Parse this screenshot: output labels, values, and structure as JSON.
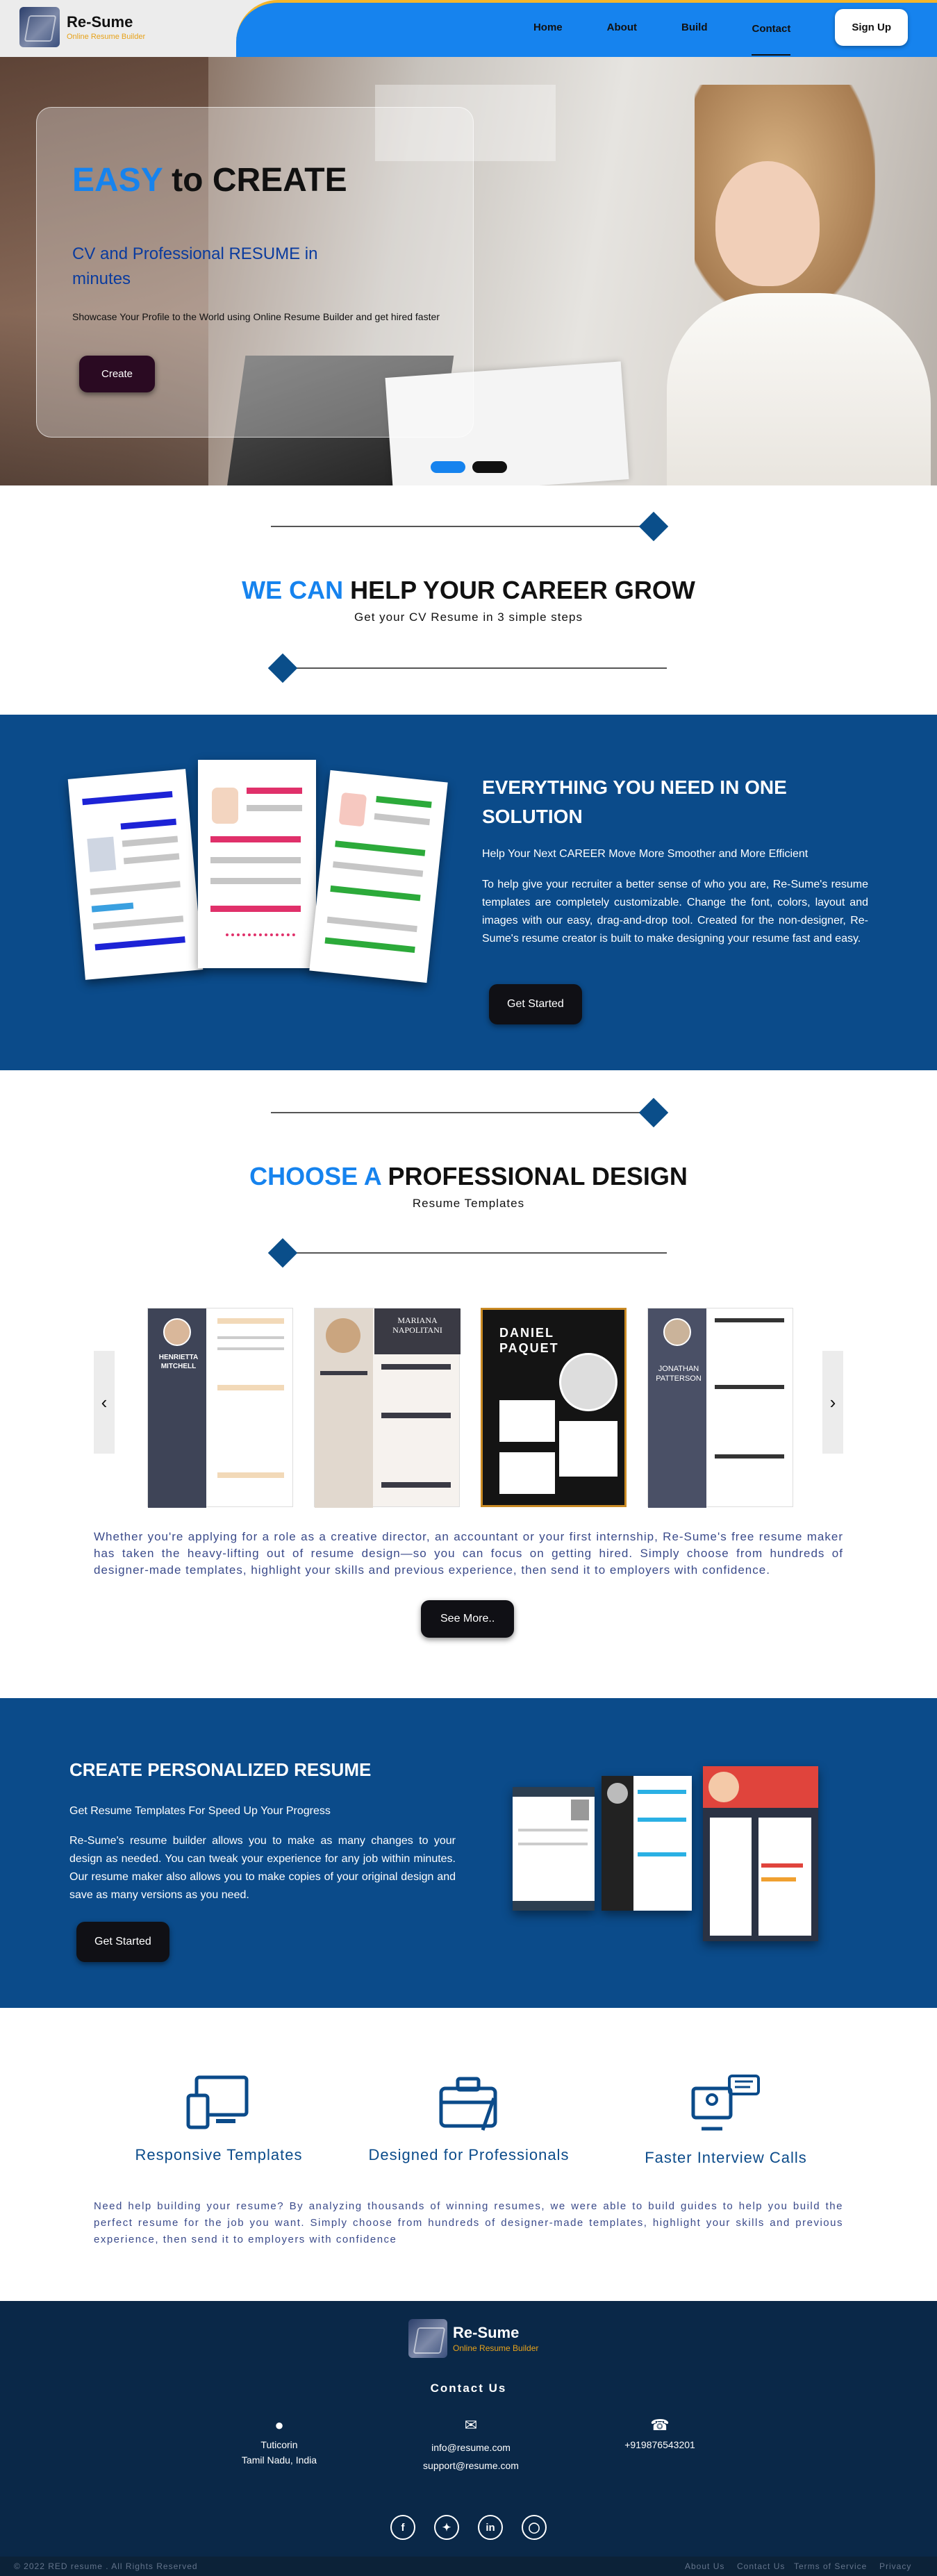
{
  "nav": {
    "brand": "Re-Sume",
    "tagline": "Online Resume Builder",
    "links": [
      "Home",
      "About",
      "Build",
      "Contact"
    ],
    "signup": "Sign Up"
  },
  "hero": {
    "title_hl": "EASY",
    "title_rest": " to CREATE",
    "subtitle": "CV and Professional RESUME in minutes",
    "desc": "Showcase Your Profile to the World using Online Resume Builder and get hired faster",
    "button": "Create",
    "colors": {
      "accent": "#1683ee",
      "dot_active": "#1683ee",
      "dot_inactive": "#111111"
    }
  },
  "help": {
    "title_hl": "WE CAN",
    "title_rest": " HELP YOUR CAREER GROW",
    "subtitle": "Get your CV Resume in 3 simple steps"
  },
  "solution": {
    "title": "EVERYTHING YOU NEED IN ONE SOLUTION",
    "lead": "Help Your Next CAREER Move More Smoother and More Efficient",
    "body": "To help give your recruiter a better sense of who you are, Re-Sume's resume templates are completely customizable. Change the font, colors, layout and images with our easy, drag-and-drop tool. Created for the non-designer, Re-Sume's resume creator is built to make designing your resume fast and easy.",
    "button": "Get Started"
  },
  "design": {
    "title_hl": "CHOOSE A",
    "title_rest": " PROFESSIONAL DESIGN",
    "subtitle": "Resume Templates",
    "templates": [
      {
        "name": "HENRIETTA MITCHELL"
      },
      {
        "name": "MARIANA NAPOLITANI"
      },
      {
        "name": "DANIEL PAQUET"
      },
      {
        "name": "JONATHAN PATTERSON"
      }
    ],
    "prev_icon": "‹",
    "next_icon": "›",
    "paragraph": "Whether you're applying for a role as a creative director, an accountant or your first internship, Re-Sume's free resume maker has taken the heavy-lifting out of resume design—so you can focus on getting hired. Simply choose from hundreds of designer-made templates, highlight your skills and previous experience, then send it to employers with confidence.",
    "button": "See More.."
  },
  "personalized": {
    "title": "CREATE PERSONALIZED RESUME",
    "lead": "Get Resume Templates For Speed Up Your Progress",
    "body": "Re-Sume's resume builder allows you to make as many changes to your design as needed. You can tweak your experience for any job within minutes. Our resume maker also allows you to make copies of your original design and save as many versions as you need.",
    "button": "Get Started"
  },
  "features": {
    "items": [
      "Responsive Templates",
      "Designed for Professionals",
      "Faster Interview Calls"
    ],
    "paragraph": "Need help building your resume? By analyzing thousands of winning resumes, we were able to build guides to help you build the perfect resume for the job you want. Simply choose from hundreds of designer-made templates, highlight your skills and previous experience, then send it to employers with confidence"
  },
  "footer": {
    "brand": "Re-Sume",
    "tagline": "Online Resume Builder",
    "contact_title": "Contact Us",
    "city": "Tuticorin",
    "state": "Tamil Nadu, India",
    "email1": "info@resume.com",
    "email2": "support@resume.com",
    "phone": "+919876543201",
    "copyright": "© 2022 RED resume . All Rights Reserved",
    "links": [
      "About Us",
      "Contact Us",
      "Terms of Service",
      "Privacy"
    ]
  }
}
